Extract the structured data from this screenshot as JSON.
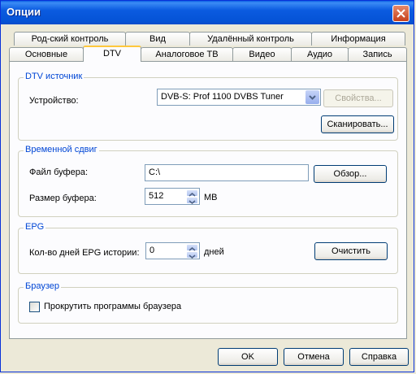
{
  "window": {
    "title": "Опции"
  },
  "tabs_back": [
    "Род-ский контроль",
    "Вид",
    "Удалённый контроль",
    "Информация"
  ],
  "tabs_front": [
    "Основные",
    "DTV",
    "Аналоговое ТВ",
    "Видео",
    "Аудио",
    "Запись"
  ],
  "active_tab": "DTV",
  "dtv_source": {
    "title": "DTV источник",
    "device_label": "Устройство:",
    "device_value": "DVB-S: Prof 1100 DVBS Tuner",
    "properties_button": "Свойства...",
    "scan_button": "Сканировать..."
  },
  "timeshift": {
    "title": "Временной сдвиг",
    "buffer_file_label": "Файл буфера:",
    "buffer_file_value": "C:\\",
    "browse_button": "Обзор...",
    "buffer_size_label": "Размер буфера:",
    "buffer_size_value": "512",
    "buffer_size_unit": "MB"
  },
  "epg": {
    "title": "EPG",
    "days_label": "Кол-во дней EPG истории:",
    "days_value": "0",
    "days_unit": "дней",
    "clear_button": "Очистить"
  },
  "browser": {
    "title": "Браузер",
    "scroll_checkbox_label": "Прокрутить программы браузера",
    "scroll_checked": false
  },
  "footer": {
    "ok": "OK",
    "cancel": "Отмена",
    "help": "Справка"
  }
}
